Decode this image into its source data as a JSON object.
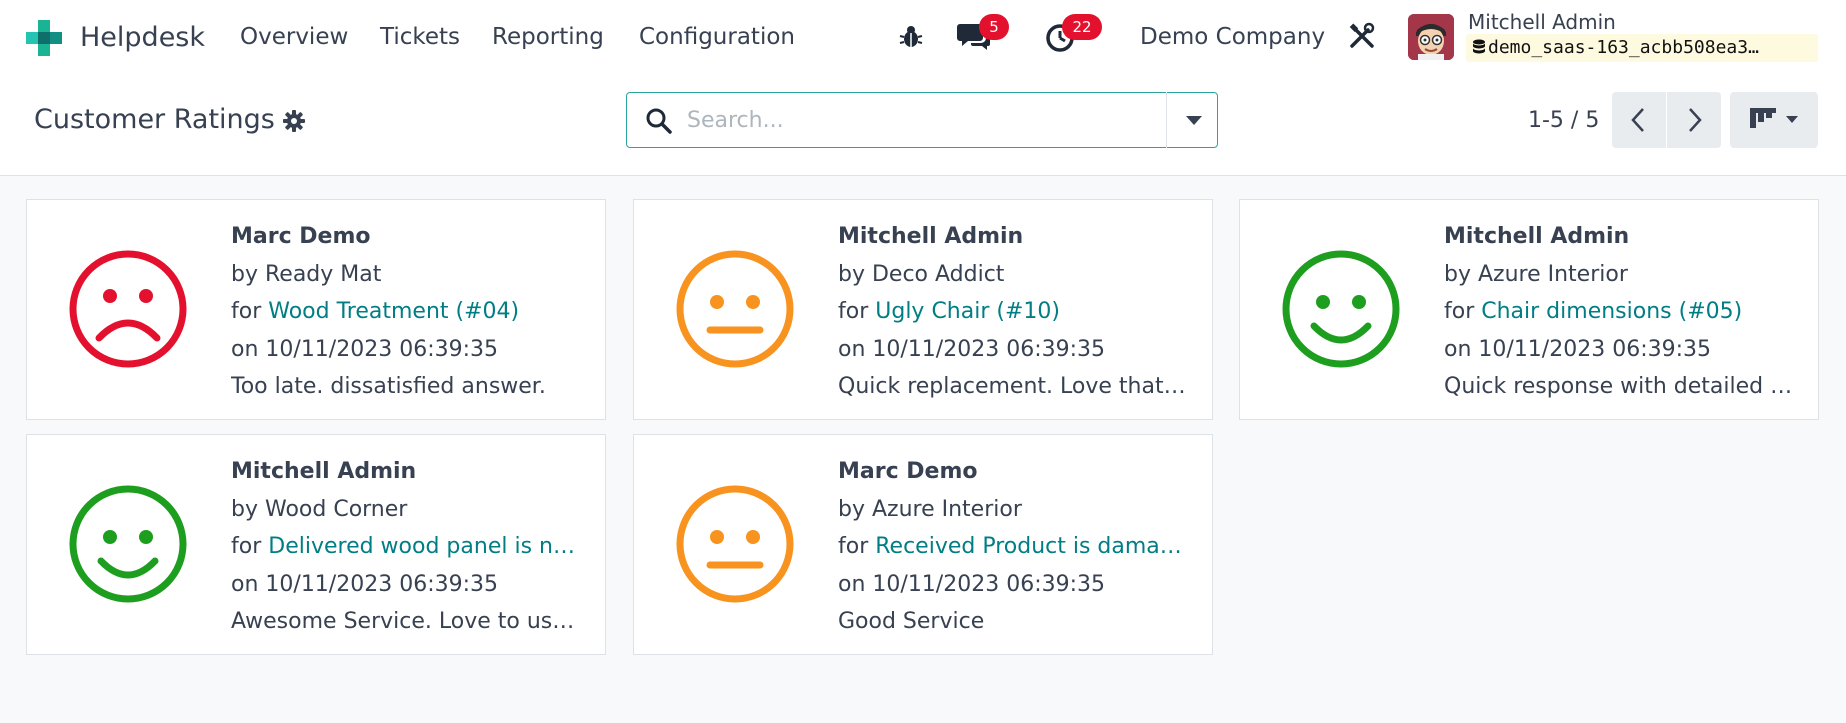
{
  "app": {
    "name": "Helpdesk",
    "menu": [
      "Overview",
      "Tickets",
      "Reporting",
      "Configuration"
    ]
  },
  "systray": {
    "messages_count": "5",
    "activities_count": "22",
    "company": "Demo Company",
    "user_name": "Mitchell Admin",
    "database": "demo_saas-163_acbb508ea3…"
  },
  "control_panel": {
    "title": "Customer Ratings",
    "search_placeholder": "Search...",
    "pager": "1-5 / 5"
  },
  "colors": {
    "accent": "#017e84",
    "dissatisfied": "#e3112d",
    "okay": "#f7931e",
    "satisfied": "#1e9e1e",
    "badge": "#e3112d"
  },
  "ratings": [
    {
      "rating": "dissatisfied",
      "name": "Marc Demo",
      "by": "Ready Mat",
      "for": "Wood Treatment (#04)",
      "on": "10/11/2023 06:39:35",
      "feedback": "Too late. dissatisfied answer."
    },
    {
      "rating": "okay",
      "name": "Mitchell Admin",
      "by": "Deco Addict",
      "for": "Ugly Chair (#10)",
      "on": "10/11/2023 06:39:35",
      "feedback": "Quick replacement. Love that…"
    },
    {
      "rating": "satisfied",
      "name": "Mitchell Admin",
      "by": "Azure Interior",
      "for": "Chair dimensions (#05)",
      "on": "10/11/2023 06:39:35",
      "feedback": "Quick response with detailed …"
    },
    {
      "rating": "satisfied",
      "name": "Mitchell Admin",
      "by": "Wood Corner",
      "for": "Delivered wood panel is n…",
      "on": "10/11/2023 06:39:35",
      "feedback": "Awesome Service. Love to us…"
    },
    {
      "rating": "okay",
      "name": "Marc Demo",
      "by": "Azure Interior",
      "for": "Received Product is dama…",
      "on": "10/11/2023 06:39:35",
      "feedback": "Good Service"
    }
  ]
}
